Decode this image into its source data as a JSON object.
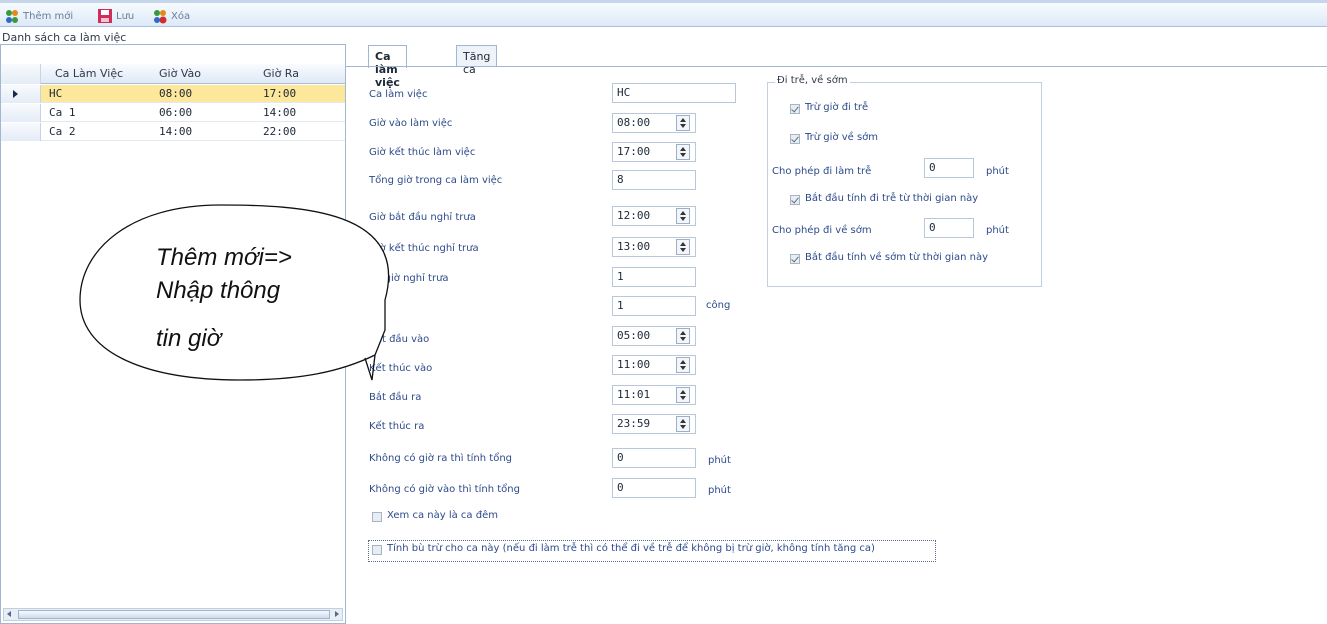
{
  "toolbar": {
    "add_label": "Thêm mới",
    "save_label": "Lưu",
    "delete_label": "Xóa"
  },
  "left_panel": {
    "title": "Danh sách ca làm việc",
    "columns": [
      "Ca Làm Việc",
      "Giờ Vào",
      "Giờ Ra"
    ],
    "rows": [
      {
        "name": "HC",
        "in": "08:00",
        "out": "17:00"
      },
      {
        "name": "Ca 1",
        "in": "06:00",
        "out": "14:00"
      },
      {
        "name": "Ca 2",
        "in": "14:00",
        "out": "22:00"
      }
    ]
  },
  "tabs": [
    "Ca làm việc",
    "Tăng ca"
  ],
  "form": {
    "ca_lam_viec": {
      "label": "Ca làm việc",
      "value": "HC"
    },
    "gio_vao": {
      "label": "Giờ vào làm việc",
      "value": "08:00"
    },
    "gio_ket_thuc": {
      "label": "Giờ kết thúc làm việc",
      "value": "17:00"
    },
    "tong_gio": {
      "label": "Tổng giờ trong ca làm việc",
      "value": "8"
    },
    "bat_dau_nghi": {
      "label": "Giờ bắt đầu nghỉ trưa",
      "value": "12:00"
    },
    "ket_thuc_nghi": {
      "label": "Giờ kết thúc nghỉ trưa",
      "value": "13:00"
    },
    "so_gio_nghi": {
      "label": "Số giờ nghỉ trưa",
      "value": "1"
    },
    "so_cong": {
      "value": "1",
      "unit": "công"
    },
    "bat_dau_vao": {
      "label": "Bắt đầu vào",
      "value": "05:00"
    },
    "ket_thuc_vao": {
      "label": "Kết thúc vào",
      "value": "11:00"
    },
    "bat_dau_ra": {
      "label": "Bắt đầu ra",
      "value": "11:01"
    },
    "ket_thuc_ra": {
      "label": "Kết thúc ra",
      "value": "23:59"
    },
    "khong_gio_ra": {
      "label": "Không có giờ ra thì tính tổng",
      "value": "0",
      "unit": "phút"
    },
    "khong_gio_vao": {
      "label": "Không có giờ vào thì tính tổng",
      "value": "0",
      "unit": "phút"
    },
    "ca_dem_label": "Xem ca này là ca đêm",
    "bu_tru_label": "Tính bù trừ cho ca này (nếu đi làm trễ thì có thể đi về trễ để không bị trừ giờ, không tính tăng ca)"
  },
  "late_early": {
    "title": "Đi trễ, về sớm",
    "tru_di_tre": "Trừ giờ đi trễ",
    "tru_ve_som": "Trừ giờ về sớm",
    "cho_phep_tre_label": "Cho phép đi làm trễ",
    "cho_phep_tre_value": "0",
    "cho_phep_tre_unit": "phút",
    "bat_dau_tinh_tre": "Bắt đầu tính đi trễ từ thời gian này",
    "cho_phep_som_label": "Cho phép đi về sớm",
    "cho_phep_som_value": "0",
    "cho_phep_som_unit": "phút",
    "bat_dau_tinh_som": "Bắt đầu tính về sớm từ thời gian này"
  },
  "callout": {
    "line1": "Thêm mới=>",
    "line2": "Nhập thông",
    "line3": "tin giờ"
  }
}
